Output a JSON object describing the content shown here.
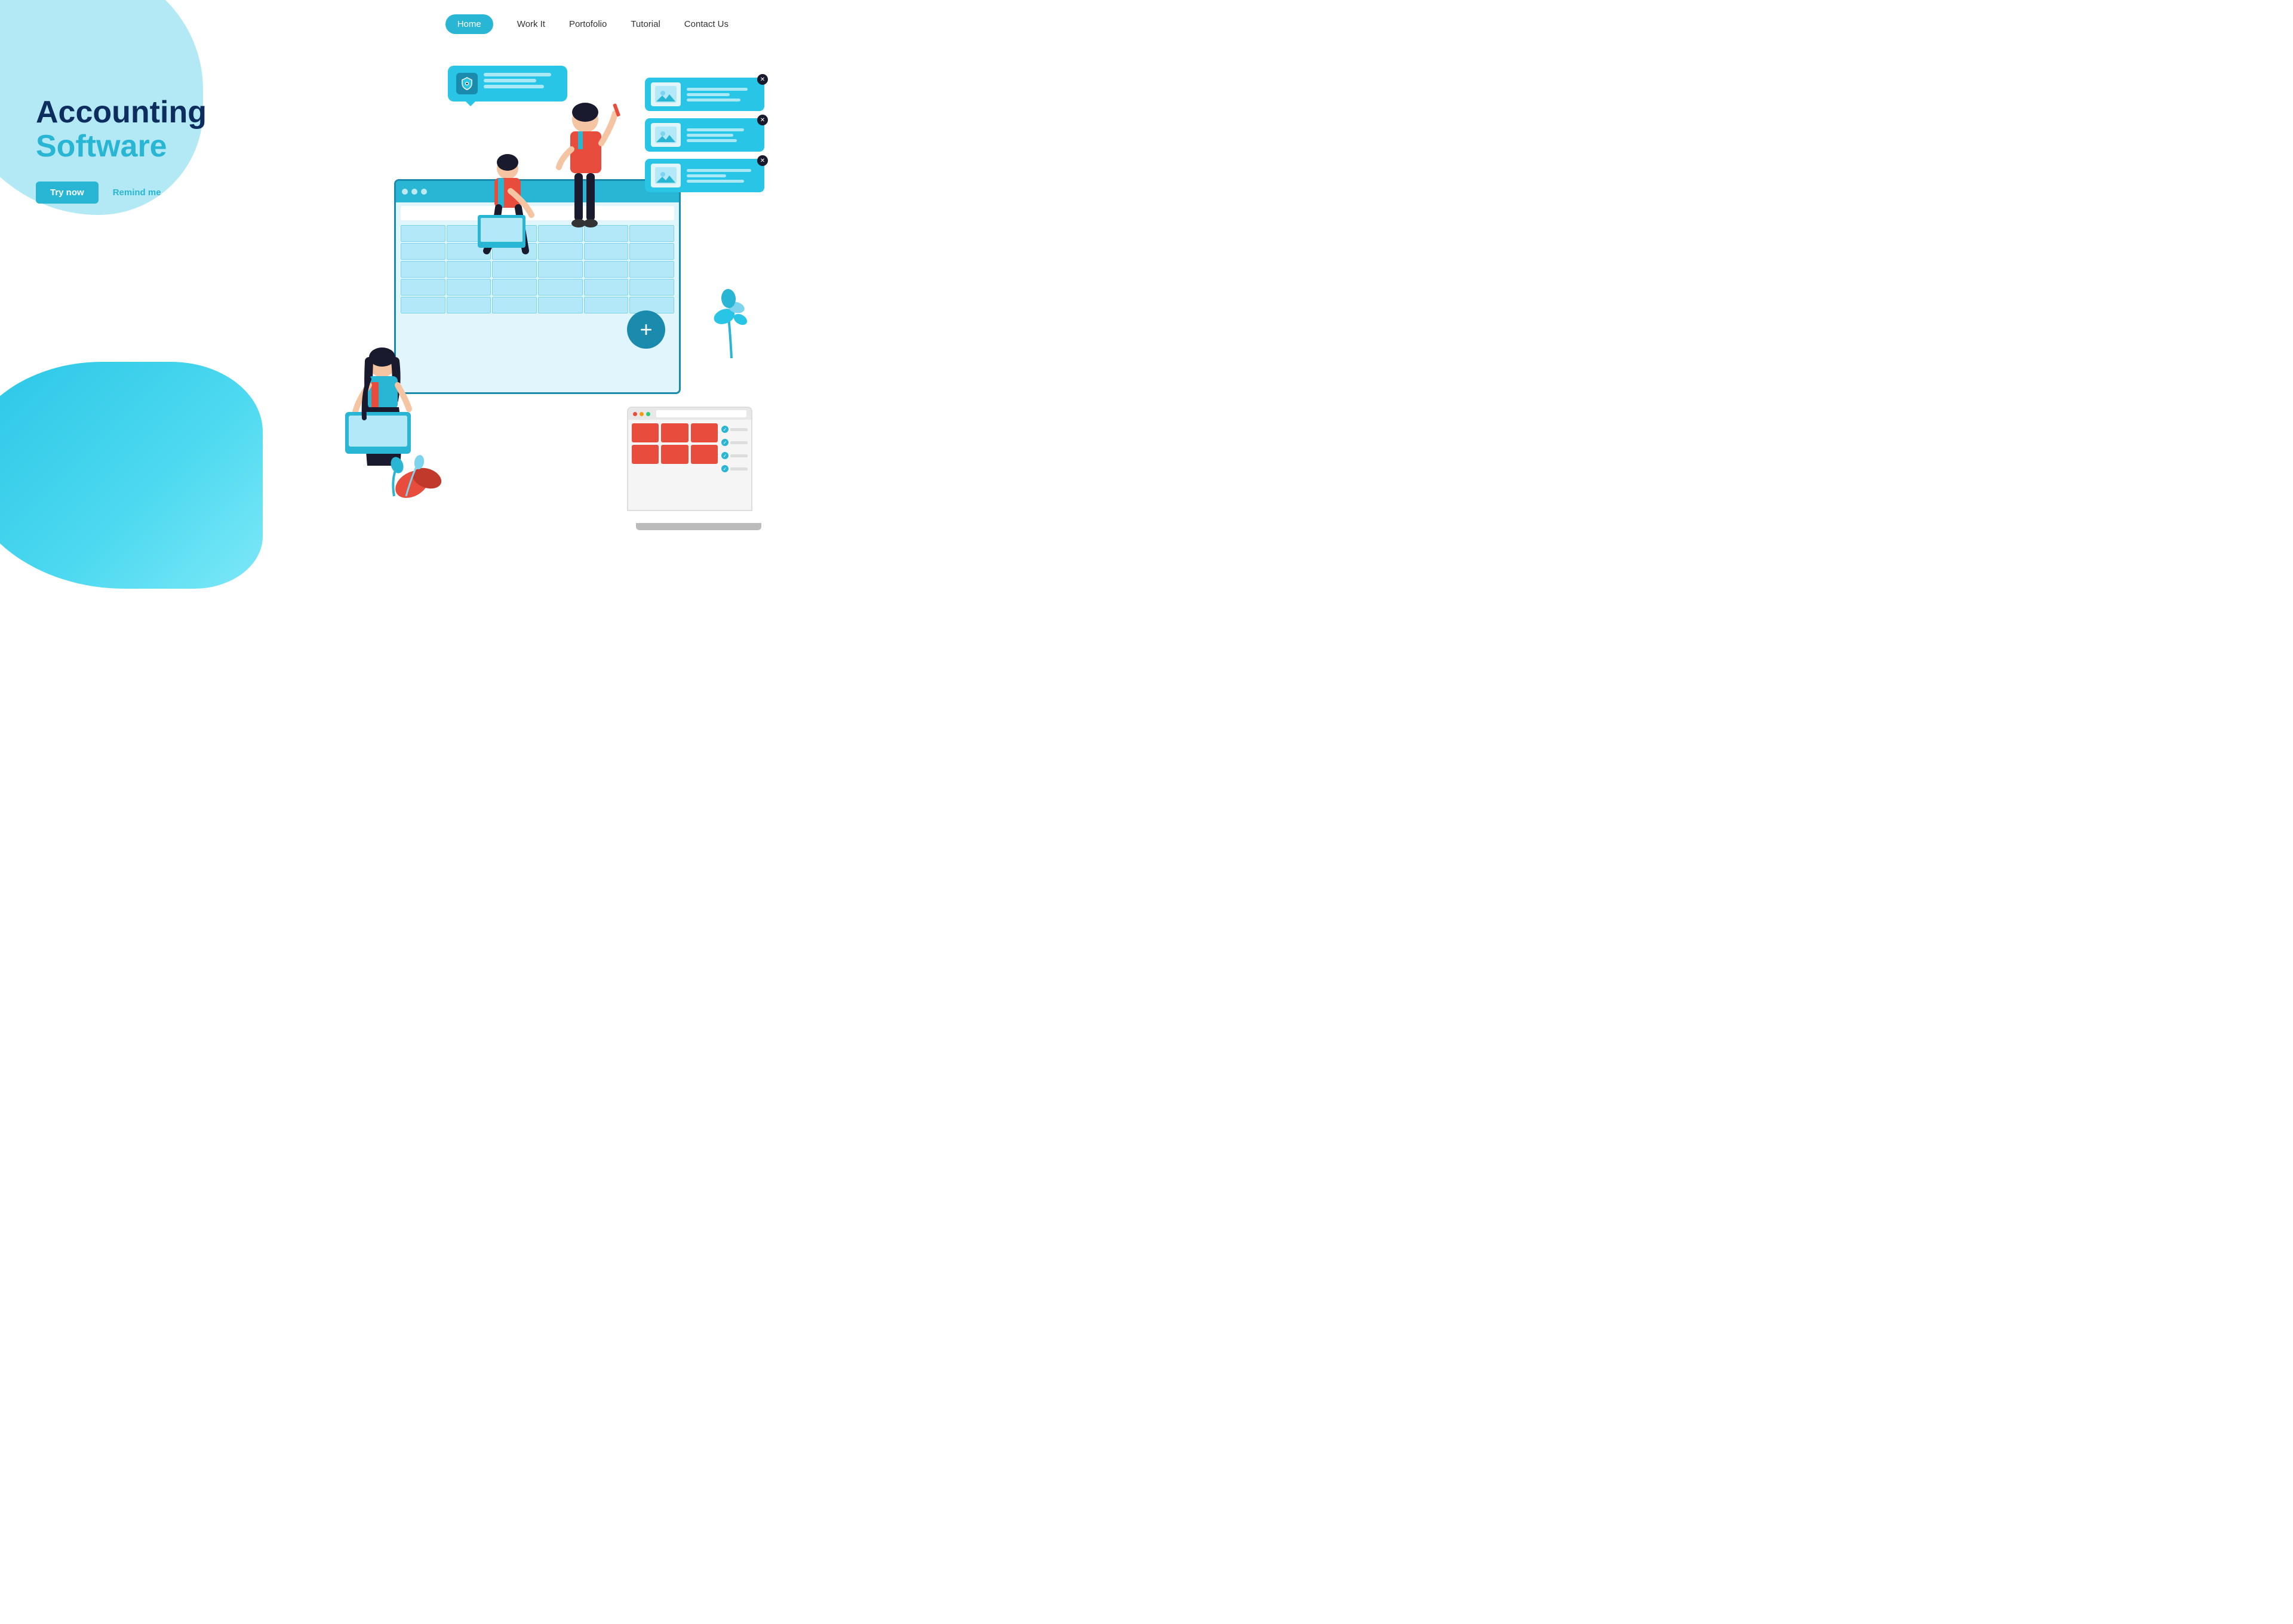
{
  "nav": {
    "items": [
      {
        "id": "home",
        "label": "Home",
        "active": true
      },
      {
        "id": "work-it",
        "label": "Work It",
        "active": false
      },
      {
        "id": "portfolio",
        "label": "Portofolio",
        "active": false
      },
      {
        "id": "tutorial",
        "label": "Tutorial",
        "active": false
      },
      {
        "id": "contact",
        "label": "Contact Us",
        "active": false
      }
    ]
  },
  "hero": {
    "title_line1": "Accounting",
    "title_line2": "Software",
    "cta_primary": "Try now",
    "cta_secondary": "Remind me"
  },
  "colors": {
    "primary": "#29b6d4",
    "dark_blue": "#0d2d5e",
    "light_blue": "#b3e8f5",
    "medium_blue": "#29c5e6",
    "red_orange": "#e74c3c"
  }
}
